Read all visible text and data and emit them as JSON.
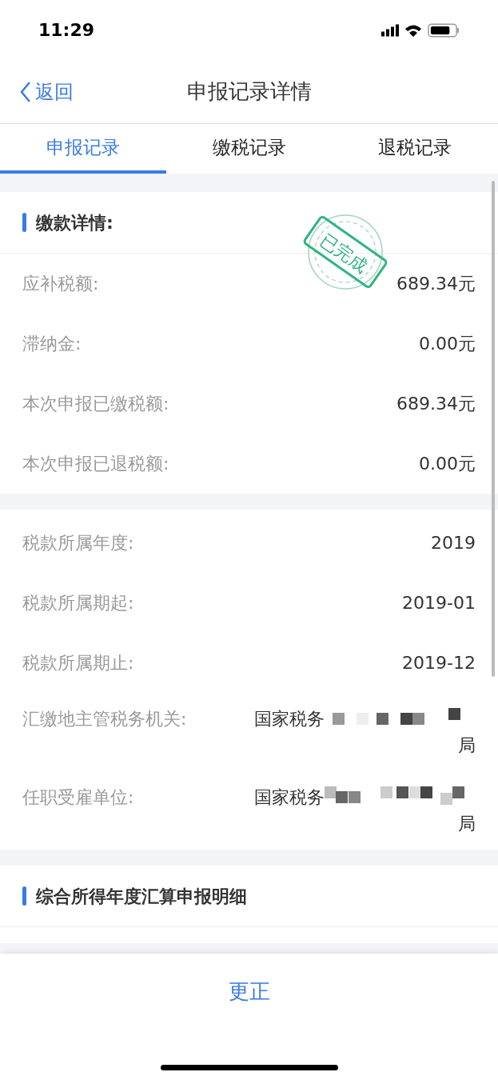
{
  "status_bar": {
    "time": "11:29"
  },
  "nav": {
    "back": "返回",
    "title": "申报记录详情"
  },
  "tabs": [
    {
      "label": "申报记录",
      "selected": true
    },
    {
      "label": "缴税记录",
      "selected": false
    },
    {
      "label": "退税记录",
      "selected": false
    }
  ],
  "payment_section": {
    "title": "缴款详情:",
    "stamp": "已完成",
    "rows": [
      {
        "label": "应补税额:",
        "value": "689.34元"
      },
      {
        "label": "滞纳金:",
        "value": "0.00元"
      },
      {
        "label": "本次申报已缴税额:",
        "value": "689.34元"
      },
      {
        "label": "本次申报已退税额:",
        "value": "0.00元"
      }
    ]
  },
  "period_rows": [
    {
      "label": "税款所属年度:",
      "value": "2019"
    },
    {
      "label": "税款所属期起:",
      "value": "2019-01"
    },
    {
      "label": "税款所属期止:",
      "value": "2019-12"
    },
    {
      "label": "汇缴地主管税务机关:",
      "value": "国家税务",
      "value_end": "局",
      "redacted": true
    },
    {
      "label": "任职受雇单位:",
      "value": "国家税务",
      "value_end": "局",
      "redacted": true
    }
  ],
  "detail_section": {
    "title": "综合所得年度汇算申报明细"
  },
  "footer": {
    "button": "更正"
  }
}
